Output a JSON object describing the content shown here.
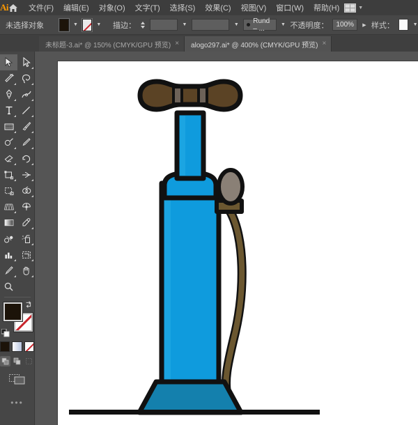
{
  "app": {
    "name": "Ai",
    "logo_label": "Ai",
    "home_icon": "home-icon",
    "arrange_icon": "arrange-documents-icon"
  },
  "menubar": {
    "items": [
      {
        "label": "文件(F)"
      },
      {
        "label": "编辑(E)"
      },
      {
        "label": "对象(O)"
      },
      {
        "label": "文字(T)"
      },
      {
        "label": "选择(S)"
      },
      {
        "label": "效果(C)"
      },
      {
        "label": "视图(V)"
      },
      {
        "label": "窗口(W)"
      },
      {
        "label": "帮助(H)"
      }
    ]
  },
  "controlbar": {
    "selection_status": "未选择对象",
    "fill_swatch_name": "fill-color-swatch",
    "fill_color": "#1d1409",
    "stroke_swatch_name": "stroke-none-swatch",
    "stroke_label": "描边：",
    "stroke_weight_value": "",
    "stroke_profile_value": "",
    "brush_value": "Rund – ...",
    "opacity_label": "不透明度：",
    "opacity_value": "100%",
    "style_label": "样式："
  },
  "tabs": [
    {
      "title": "未标题-3.ai* @ 150% (CMYK/GPU 预览)",
      "close": "×",
      "active": false
    },
    {
      "title": "alogo297.ai* @ 400% (CMYK/GPU 预览)",
      "close": "×",
      "active": true
    }
  ],
  "toolbar": {
    "tools": [
      {
        "name": "selection-tool",
        "selected": true,
        "corner": false
      },
      {
        "name": "direct-selection-tool",
        "selected": false,
        "corner": true
      },
      {
        "name": "magic-wand-tool",
        "selected": false,
        "corner": false
      },
      {
        "name": "lasso-tool",
        "selected": false,
        "corner": false
      },
      {
        "name": "pen-tool",
        "selected": false,
        "corner": true
      },
      {
        "name": "curvature-tool",
        "selected": false,
        "corner": false
      },
      {
        "name": "type-tool",
        "selected": false,
        "corner": true
      },
      {
        "name": "line-segment-tool",
        "selected": false,
        "corner": true
      },
      {
        "name": "rectangle-tool",
        "selected": false,
        "corner": true
      },
      {
        "name": "paintbrush-tool",
        "selected": false,
        "corner": true
      },
      {
        "name": "shaper-tool",
        "selected": false,
        "corner": true
      },
      {
        "name": "pencil-tool",
        "selected": false,
        "corner": true
      },
      {
        "name": "eraser-tool",
        "selected": false,
        "corner": true
      },
      {
        "name": "rotate-tool",
        "selected": false,
        "corner": true
      },
      {
        "name": "scale-tool",
        "selected": false,
        "corner": true
      },
      {
        "name": "width-tool",
        "selected": false,
        "corner": true
      },
      {
        "name": "free-transform-tool",
        "selected": false,
        "corner": false
      },
      {
        "name": "shape-builder-tool",
        "selected": false,
        "corner": true
      },
      {
        "name": "perspective-grid-tool",
        "selected": false,
        "corner": true
      },
      {
        "name": "mesh-tool",
        "selected": false,
        "corner": false
      },
      {
        "name": "gradient-tool",
        "selected": false,
        "corner": false
      },
      {
        "name": "eyedropper-tool",
        "selected": false,
        "corner": true
      },
      {
        "name": "blend-tool",
        "selected": false,
        "corner": false
      },
      {
        "name": "symbol-sprayer-tool",
        "selected": false,
        "corner": true
      },
      {
        "name": "column-graph-tool",
        "selected": false,
        "corner": true
      },
      {
        "name": "artboard-tool",
        "selected": false,
        "corner": false
      },
      {
        "name": "slice-tool",
        "selected": false,
        "corner": true
      },
      {
        "name": "hand-tool",
        "selected": false,
        "corner": true
      },
      {
        "name": "zoom-tool",
        "selected": false,
        "corner": false
      }
    ],
    "fill_name": "fill-color",
    "fill_color": "#1c1309",
    "stroke_name": "stroke-color-none",
    "swap_icon": "swap-fill-stroke-icon",
    "default_icon": "default-fill-stroke-icon",
    "color_mode_color": "#1c1309",
    "modes": [
      "color-swatch",
      "gradient-swatch",
      "none-swatch"
    ],
    "drawing_modes": [
      "draw-normal",
      "draw-behind",
      "draw-inside"
    ],
    "screen_mode": "change-screen-mode",
    "edit_toolbar": "•••"
  },
  "artwork": {
    "name": "bicycle-floor-pump-illustration",
    "colors": {
      "body_blue": "#0f9bdd",
      "body_blue_light": "#1ba5e2",
      "base_blue": "#1480ad",
      "handle_brown": "#5b4325",
      "handle_band": "#6d6258",
      "rod_brown": "#6b5730",
      "hose_brown": "#6b5730",
      "valve_gray": "#8a8076",
      "outline": "#111111",
      "ground_line": "#111111"
    }
  }
}
